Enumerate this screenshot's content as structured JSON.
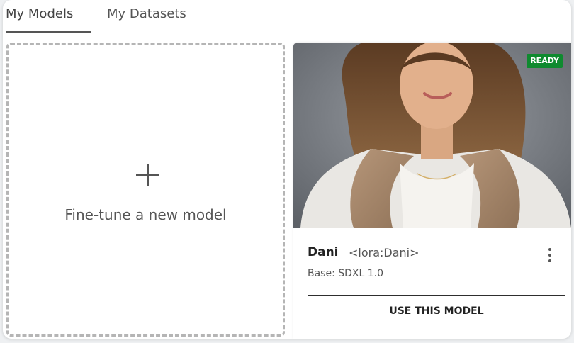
{
  "tabs": [
    {
      "label": "My Models",
      "active": true
    },
    {
      "label": "My Datasets",
      "active": false
    }
  ],
  "new_model_card": {
    "icon": "plus-icon",
    "label": "Fine-tune a new model"
  },
  "model_card": {
    "status": "READY",
    "status_color": "#0f8a2f",
    "name": "Dani",
    "trigger": "<lora:Dani>",
    "base": "Base: SDXL 1.0",
    "menu_icon": "kebab-icon",
    "use_label": "USE THIS MODEL"
  }
}
